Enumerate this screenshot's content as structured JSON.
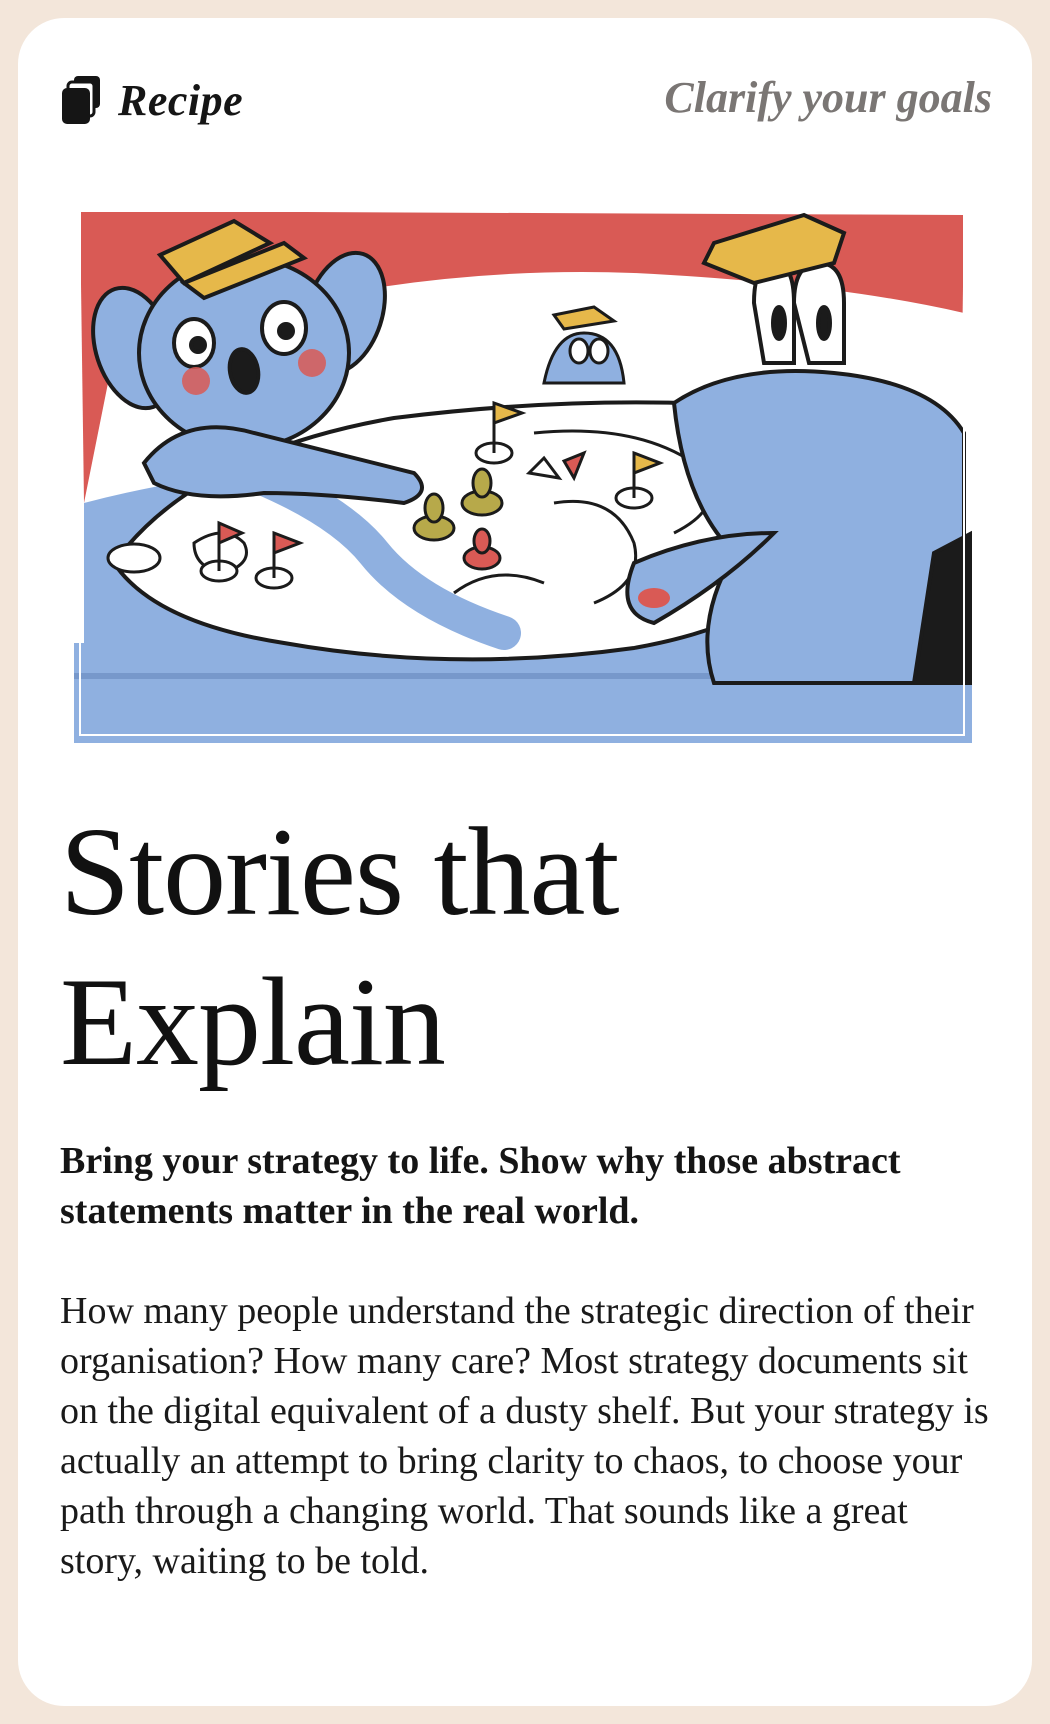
{
  "header": {
    "label": "Recipe",
    "category": "Clarify your goals",
    "icon": "card-stack-icon"
  },
  "illustration": {
    "icon": "illustration-map-strategy",
    "colors": {
      "red": "#d95a55",
      "blue": "#8fb0e0",
      "yellow": "#e6b84a",
      "ink": "#1b1b1b"
    }
  },
  "title": "Stories that Explain",
  "lead": "Bring your strategy to life. Show why those abstract statements matter in the real world.",
  "body": "How many people understand the strategic direction of their organisation? How many care? Most strategy documents sit on the digital equivalent of a dusty shelf. But your strategy is actually an attempt to bring clarity to chaos, to choose your path through a changing world. That sounds like a great story, waiting to be told.",
  "colors": {
    "page_background": "#f3e6da",
    "card_background": "#ffffff",
    "text": "#151515",
    "muted_text": "#7a7674"
  }
}
